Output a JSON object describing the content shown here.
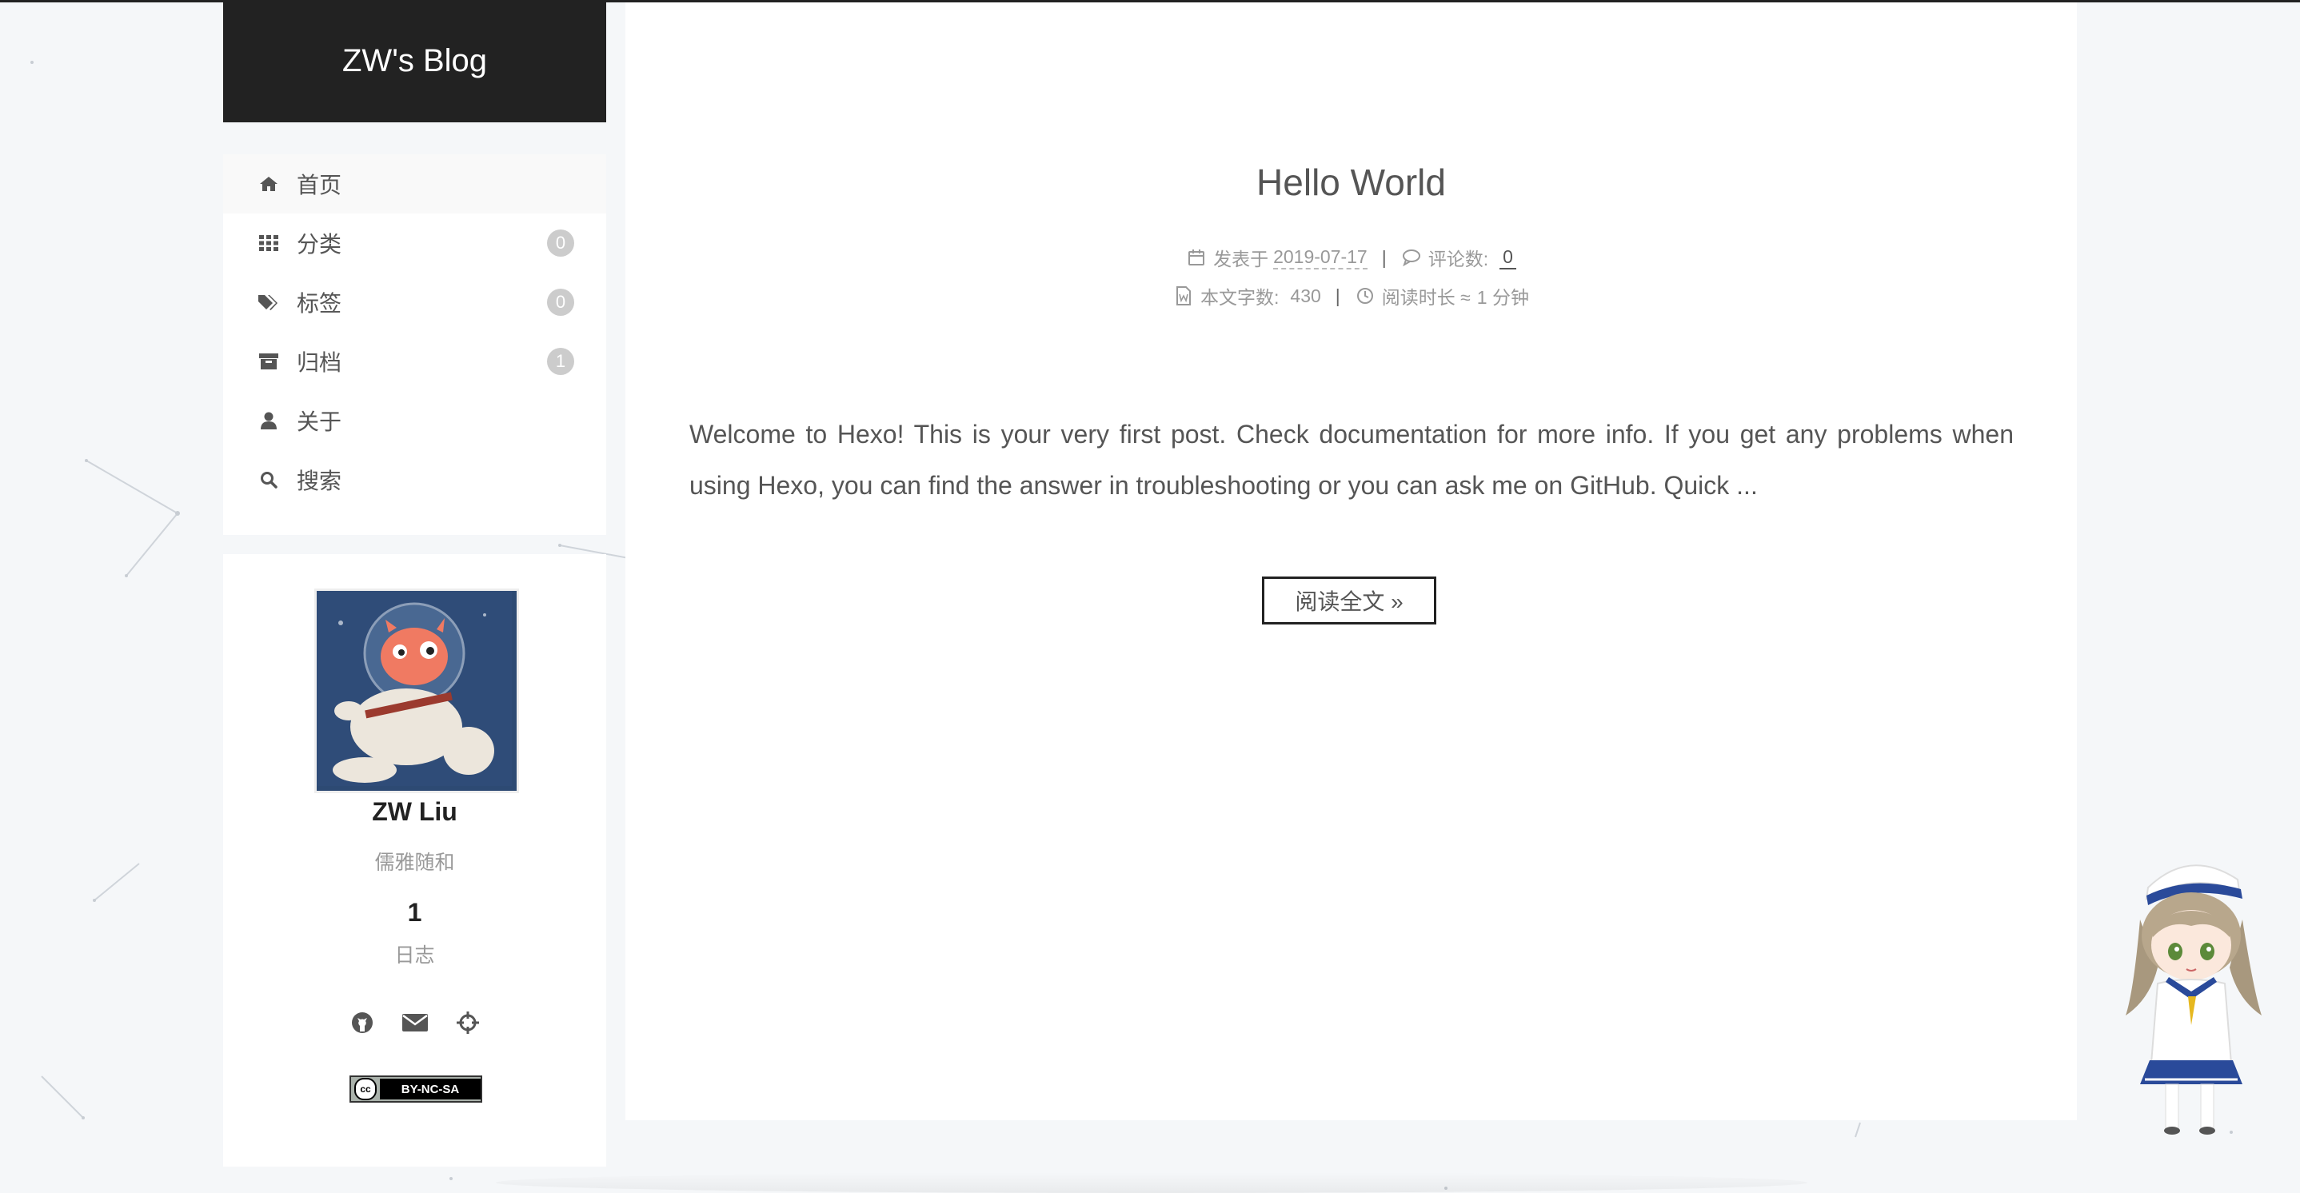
{
  "site": {
    "title": "ZW's Blog"
  },
  "menu": {
    "items": [
      {
        "label": "首页",
        "icon": "home-icon",
        "badge": ""
      },
      {
        "label": "分类",
        "icon": "th-icon",
        "badge": "0"
      },
      {
        "label": "标签",
        "icon": "tags-icon",
        "badge": "0"
      },
      {
        "label": "归档",
        "icon": "archive-icon",
        "badge": "1"
      },
      {
        "label": "关于",
        "icon": "user-icon",
        "badge": ""
      },
      {
        "label": "搜索",
        "icon": "search-icon",
        "badge": ""
      }
    ]
  },
  "author": {
    "name": "ZW Liu",
    "description": "儒雅随和",
    "posts_count": "1",
    "posts_label": "日志",
    "links": [
      "github-icon",
      "envelope-icon",
      "crosshairs-icon"
    ],
    "license": {
      "cc": "cc",
      "text": "BY-NC-SA"
    }
  },
  "post": {
    "title": "Hello World",
    "posted_label": "发表于",
    "date": "2019-07-17",
    "comments_label": "评论数:",
    "comments_count": "0",
    "wordcount_label": "本文字数:",
    "wordcount": "430",
    "readtime_label": "阅读时长 ≈",
    "readtime": "1 分钟",
    "excerpt": "Welcome to Hexo! This is your very first post. Check documentation for more info. If you get any problems when using Hexo, you can find the answer in troubleshooting or you can ask me on GitHub. Quick ...",
    "read_more": "阅读全文 »"
  },
  "colors": {
    "header_bg": "#222222",
    "page_bg": "#f5f7f9",
    "badge_bg": "#cccccc"
  }
}
